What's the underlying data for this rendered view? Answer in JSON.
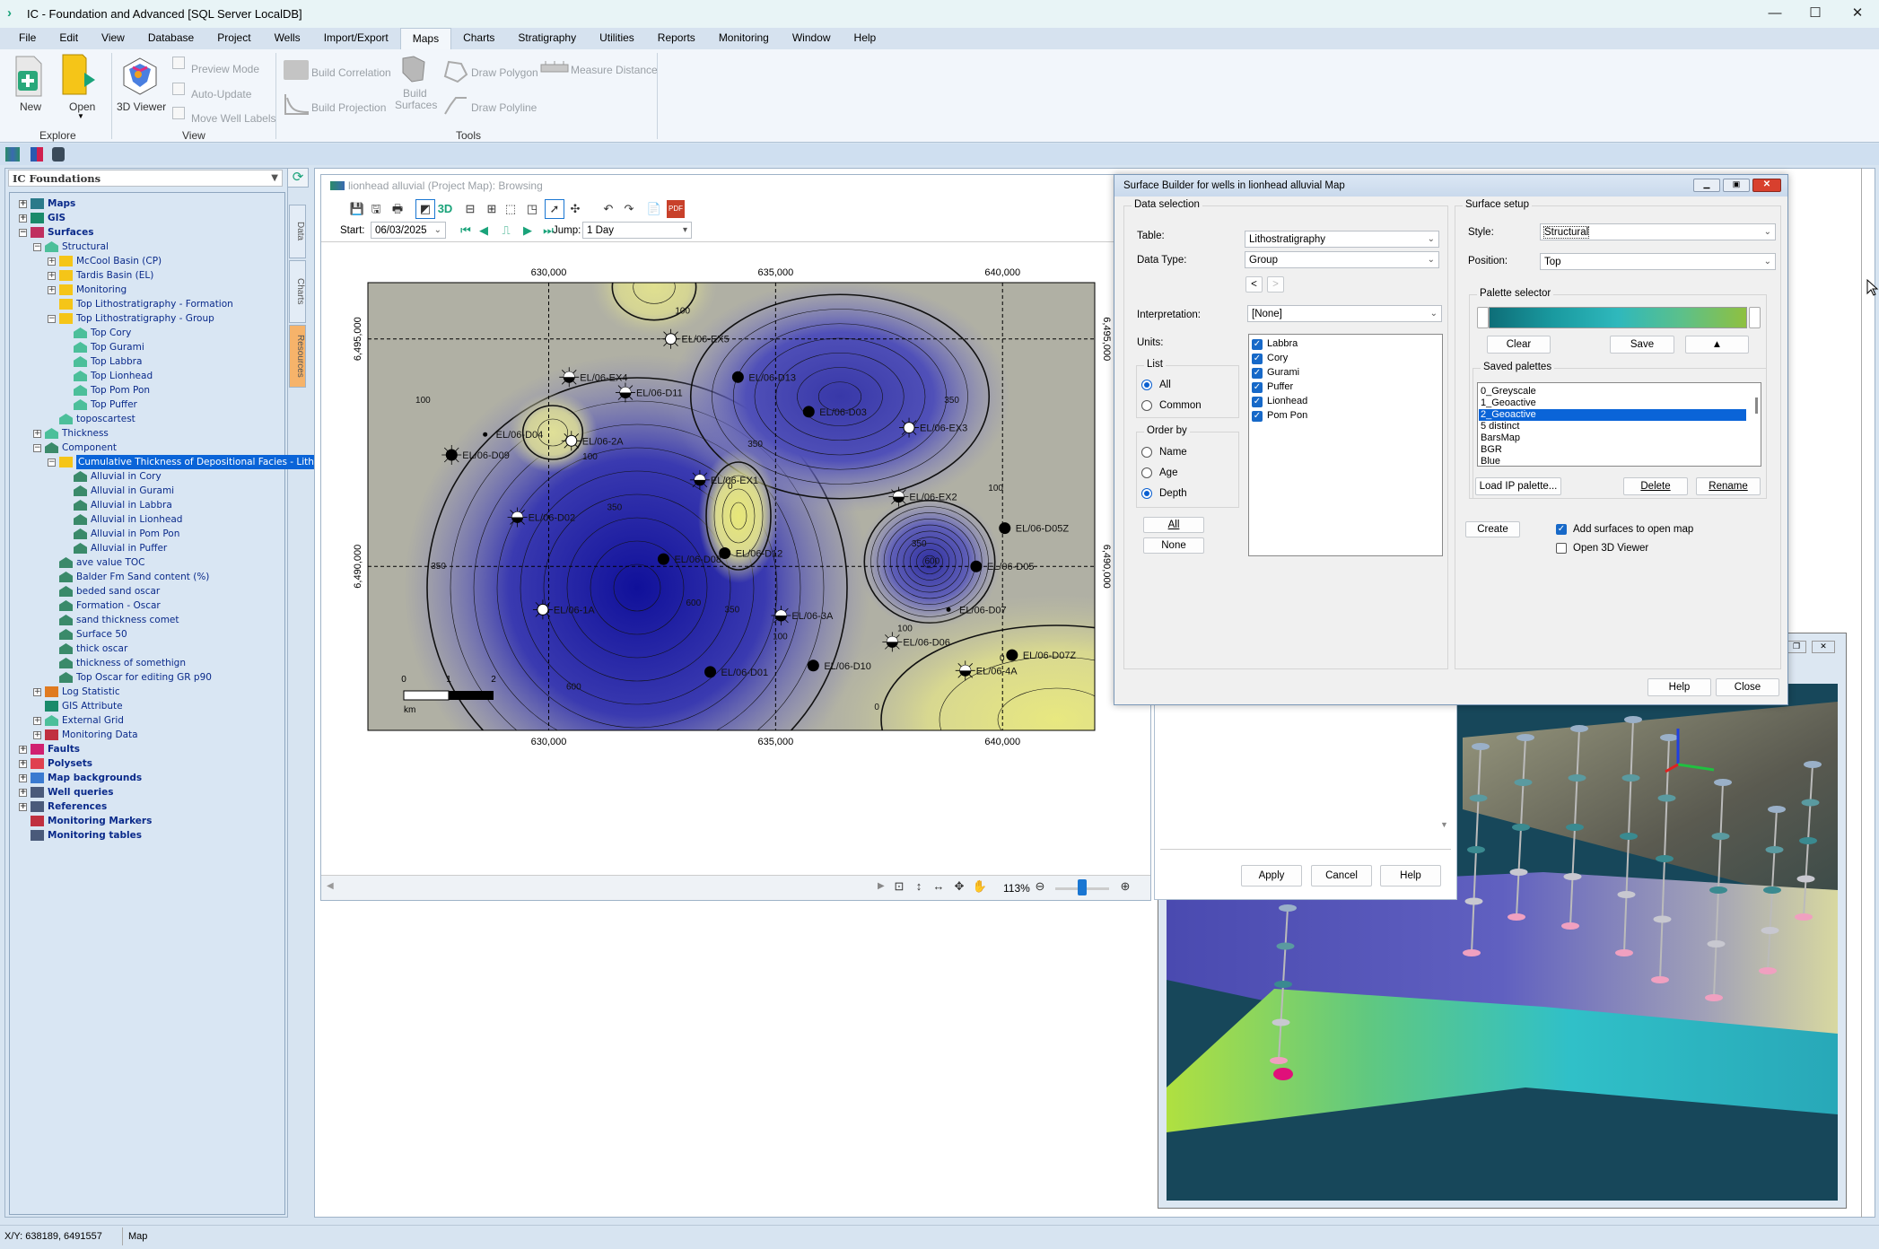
{
  "window": {
    "title": "IC - Foundation and Advanced [SQL Server LocalDB]",
    "controls": [
      "minimize",
      "maximize",
      "close"
    ]
  },
  "menu": [
    "File",
    "Edit",
    "View",
    "Database",
    "Project",
    "Wells",
    "Import/Export",
    "Maps",
    "Charts",
    "Stratigraphy",
    "Utilities",
    "Reports",
    "Monitoring",
    "Window",
    "Help"
  ],
  "menu_active": "Maps",
  "ribbon": {
    "new": "New",
    "open": "Open",
    "explore": "Explore",
    "viewer3d": "3D Viewer",
    "preview_mode": "Preview Mode",
    "auto_update": "Auto-Update",
    "move_well_labels": "Move Well Labels",
    "view": "View",
    "build_correlation": "Build Correlation",
    "build_projection": "Build Projection",
    "build_surfaces_1": "Build",
    "build_surfaces_2": "Surfaces",
    "draw_polygon": "Draw Polygon",
    "draw_polyline": "Draw Polyline",
    "measure_distance": "Measure Distance",
    "tools": "Tools"
  },
  "left_panel": {
    "project_select": "IC Foundations",
    "side_tabs": [
      "Data",
      "Charts",
      "Resources"
    ],
    "tree": [
      {
        "l": 0,
        "t": "Maps",
        "e": "+",
        "i": "maps",
        "b": true
      },
      {
        "l": 0,
        "t": "GIS",
        "e": "+",
        "i": "gis",
        "b": true
      },
      {
        "l": 0,
        "t": "Surfaces",
        "e": "-",
        "i": "surfaces",
        "b": true
      },
      {
        "l": 1,
        "t": "Structural",
        "e": "-",
        "i": "surf"
      },
      {
        "l": 2,
        "t": "McCool Basin (CP)",
        "e": "+",
        "i": "folder"
      },
      {
        "l": 2,
        "t": "Tardis Basin (EL)",
        "e": "+",
        "i": "folder"
      },
      {
        "l": 2,
        "t": "Monitoring",
        "e": "+",
        "i": "folder"
      },
      {
        "l": 2,
        "t": "Top Lithostratigraphy - Formation",
        "e": "",
        "i": "folder"
      },
      {
        "l": 2,
        "t": "Top Lithostratigraphy - Group",
        "e": "-",
        "i": "folder"
      },
      {
        "l": 3,
        "t": "Top Cory",
        "e": "",
        "i": "surf"
      },
      {
        "l": 3,
        "t": "Top Gurami",
        "e": "",
        "i": "surf"
      },
      {
        "l": 3,
        "t": "Top Labbra",
        "e": "",
        "i": "surf"
      },
      {
        "l": 3,
        "t": "Top Lionhead",
        "e": "",
        "i": "surf"
      },
      {
        "l": 3,
        "t": "Top Pom Pon",
        "e": "",
        "i": "surf"
      },
      {
        "l": 3,
        "t": "Top Puffer",
        "e": "",
        "i": "surf"
      },
      {
        "l": 2,
        "t": "toposcartest",
        "e": "",
        "i": "surf"
      },
      {
        "l": 1,
        "t": "Thickness",
        "e": "+",
        "i": "thick"
      },
      {
        "l": 1,
        "t": "Component",
        "e": "-",
        "i": "comp"
      },
      {
        "l": 2,
        "t": "Cumulative Thickness of Depositional Facies - Lith",
        "e": "-",
        "i": "folder",
        "s": true
      },
      {
        "l": 3,
        "t": "Alluvial in Cory",
        "e": "",
        "i": "comp"
      },
      {
        "l": 3,
        "t": "Alluvial in Gurami",
        "e": "",
        "i": "comp"
      },
      {
        "l": 3,
        "t": "Alluvial in Labbra",
        "e": "",
        "i": "comp"
      },
      {
        "l": 3,
        "t": "Alluvial in Lionhead",
        "e": "",
        "i": "comp"
      },
      {
        "l": 3,
        "t": "Alluvial in Pom Pon",
        "e": "",
        "i": "comp"
      },
      {
        "l": 3,
        "t": "Alluvial in Puffer",
        "e": "",
        "i": "comp"
      },
      {
        "l": 2,
        "t": "ave value TOC",
        "e": "",
        "i": "comp"
      },
      {
        "l": 2,
        "t": "Balder Fm Sand content (%)",
        "e": "",
        "i": "comp"
      },
      {
        "l": 2,
        "t": "beded sand oscar",
        "e": "",
        "i": "comp"
      },
      {
        "l": 2,
        "t": "Formation - Oscar",
        "e": "",
        "i": "comp"
      },
      {
        "l": 2,
        "t": "sand thickness comet",
        "e": "",
        "i": "comp"
      },
      {
        "l": 2,
        "t": "Surface 50",
        "e": "",
        "i": "comp"
      },
      {
        "l": 2,
        "t": "thick oscar",
        "e": "",
        "i": "comp"
      },
      {
        "l": 2,
        "t": "thickness of somethign",
        "e": "",
        "i": "comp"
      },
      {
        "l": 2,
        "t": "Top Oscar for editing GR p90",
        "e": "",
        "i": "comp"
      },
      {
        "l": 1,
        "t": "Log Statistic",
        "e": "+",
        "i": "logstat"
      },
      {
        "l": 1,
        "t": "GIS Attribute",
        "e": "",
        "i": "gis"
      },
      {
        "l": 1,
        "t": "External Grid",
        "e": "+",
        "i": "surf"
      },
      {
        "l": 1,
        "t": "Monitoring Data",
        "e": "+",
        "i": "monitor"
      },
      {
        "l": 0,
        "t": "Faults",
        "e": "+",
        "i": "faults",
        "b": true
      },
      {
        "l": 0,
        "t": "Polysets",
        "e": "+",
        "i": "polysets",
        "b": true
      },
      {
        "l": 0,
        "t": "Map backgrounds",
        "e": "+",
        "i": "bmp",
        "b": true
      },
      {
        "l": 0,
        "t": "Well queries",
        "e": "+",
        "i": "table",
        "b": true
      },
      {
        "l": 0,
        "t": "References",
        "e": "+",
        "i": "table",
        "b": true
      },
      {
        "l": 0,
        "t": "Monitoring Markers",
        "e": "",
        "i": "monitor",
        "b": true
      },
      {
        "l": 0,
        "t": "Monitoring tables",
        "e": "",
        "i": "table",
        "b": true
      }
    ]
  },
  "map_window": {
    "title": "lionhead alluvial (Project Map): Browsing",
    "toolbar": [
      "save",
      "save-as",
      "print",
      "shade",
      "3d",
      "zoom-out",
      "zoom-in",
      "zoom-select",
      "select-well",
      "pointer",
      "extent",
      "undo",
      "redo",
      "report",
      "pdf"
    ],
    "toolbar_3d_label": "3D",
    "toolbar_pdf_label": "PDF",
    "start_label": "Start:",
    "start_date": "06/03/2025",
    "jump_label": "Jump:",
    "jump_value": "1 Day",
    "zoom_level": "113%",
    "zoom_slider_fraction": 0.5
  },
  "map": {
    "extent": {
      "e_min": 626016,
      "e_max": 642032,
      "n_min": 6486395,
      "n_max": 6496237
    },
    "e_ticks": [
      "630,000",
      "635,000",
      "640,000"
    ],
    "e_tick_values": [
      630000,
      635000,
      640000
    ],
    "n_ticks": [
      "6,490,000",
      "6,495,000"
    ],
    "n_tick_values": [
      6490000,
      6495000
    ],
    "scale_bar": {
      "labels": [
        "0",
        "1",
        "2"
      ],
      "unit": "km"
    },
    "wells": [
      {
        "name": "EL/06-EX5",
        "e": 632690,
        "n": 6495000,
        "sym": "white"
      },
      {
        "name": "EL/06-EX4",
        "e": 630450,
        "n": 6494160,
        "sym": "half"
      },
      {
        "name": "EL/06-D11",
        "e": 631690,
        "n": 6493820,
        "sym": "half"
      },
      {
        "name": "EL/06-D13",
        "e": 634170,
        "n": 6494160,
        "sym": "black"
      },
      {
        "name": "EL/06-D03",
        "e": 635730,
        "n": 6493400,
        "sym": "black"
      },
      {
        "name": "EL/06-EX3",
        "e": 637940,
        "n": 6493050,
        "sym": "white"
      },
      {
        "name": "EL/06-D04",
        "e": 628600,
        "n": 6492900,
        "sym": "dot"
      },
      {
        "name": "EL/06-2A",
        "e": 630500,
        "n": 6492760,
        "sym": "white"
      },
      {
        "name": "EL/06-D09",
        "e": 627860,
        "n": 6492450,
        "sym": "star"
      },
      {
        "name": "EL/06-EX1",
        "e": 633330,
        "n": 6491900,
        "sym": "half"
      },
      {
        "name": "EL/06-EX2",
        "e": 637710,
        "n": 6491530,
        "sym": "half"
      },
      {
        "name": "EL/06-D02",
        "e": 629310,
        "n": 6491080,
        "sym": "half"
      },
      {
        "name": "EL/06-D05Z",
        "e": 640050,
        "n": 6490840,
        "sym": "black"
      },
      {
        "name": "EL/06-D12",
        "e": 633880,
        "n": 6490290,
        "sym": "black"
      },
      {
        "name": "EL/06-D08",
        "e": 632530,
        "n": 6490160,
        "sym": "black"
      },
      {
        "name": "EL/06-D05",
        "e": 639420,
        "n": 6490000,
        "sym": "black"
      },
      {
        "name": "EL/06-1A",
        "e": 629870,
        "n": 6489050,
        "sym": "white"
      },
      {
        "name": "EL/06-3A",
        "e": 635120,
        "n": 6488920,
        "sym": "half"
      },
      {
        "name": "EL/06-D07",
        "e": 638810,
        "n": 6489050,
        "sym": "dot"
      },
      {
        "name": "EL/06-D06",
        "e": 637570,
        "n": 6488340,
        "sym": "half"
      },
      {
        "name": "EL/06-D07Z",
        "e": 640210,
        "n": 6488050,
        "sym": "black"
      },
      {
        "name": "EL/06-D10",
        "e": 635830,
        "n": 6487820,
        "sym": "black"
      },
      {
        "name": "EL/06-4A",
        "e": 639180,
        "n": 6487710,
        "sym": "half"
      },
      {
        "name": "EL/06-D01",
        "e": 633560,
        "n": 6487680,
        "sym": "black"
      }
    ],
    "contour_labels": [
      {
        "t": "100",
        "e": 632950,
        "n": 6495560
      },
      {
        "t": "100",
        "e": 627230,
        "n": 6493590
      },
      {
        "t": "100",
        "e": 630910,
        "n": 6492350
      },
      {
        "t": "350",
        "e": 638880,
        "n": 6493590
      },
      {
        "t": "350",
        "e": 634550,
        "n": 6492630
      },
      {
        "t": "350",
        "e": 631450,
        "n": 6491240
      },
      {
        "t": "350",
        "e": 627570,
        "n": 6489950
      },
      {
        "t": "350",
        "e": 638160,
        "n": 6490440
      },
      {
        "t": "350",
        "e": 634040,
        "n": 6488990
      },
      {
        "t": "600",
        "e": 638450,
        "n": 6490050
      },
      {
        "t": "600",
        "e": 633190,
        "n": 6489140
      },
      {
        "t": "600",
        "e": 630550,
        "n": 6487290
      },
      {
        "t": "100",
        "e": 639850,
        "n": 6491660
      },
      {
        "t": "100",
        "e": 637850,
        "n": 6488570
      },
      {
        "t": "100",
        "e": 635100,
        "n": 6488400
      },
      {
        "t": "0",
        "e": 634000,
        "n": 6491700
      },
      {
        "t": "0",
        "e": 639990,
        "n": 6487920
      },
      {
        "t": "0",
        "e": 637230,
        "n": 6486850
      }
    ]
  },
  "dialog": {
    "title": "Surface Builder for wells in lionhead alluvial Map",
    "data_selection": "Data selection",
    "table_label": "Table:",
    "table_value": "Lithostratigraphy",
    "data_type_label": "Data Type:",
    "data_type_value": "Group",
    "prev": "<",
    "next": ">",
    "interpretation_label": "Interpretation:",
    "interpretation_value": "[None]",
    "units_label": "Units:",
    "units": [
      {
        "t": "Labbra",
        "c": true
      },
      {
        "t": "Cory",
        "c": true
      },
      {
        "t": "Gurami",
        "c": true
      },
      {
        "t": "Puffer",
        "c": true
      },
      {
        "t": "Lionhead",
        "c": true
      },
      {
        "t": "Pom Pon",
        "c": true
      }
    ],
    "list_group": "List",
    "list_all": "All",
    "list_common": "Common",
    "list_selected": "All",
    "order_group": "Order by",
    "order_name": "Name",
    "order_age": "Age",
    "order_depth": "Depth",
    "order_selected": "Depth",
    "all_button": "All",
    "none_button": "None",
    "surface_setup": "Surface setup",
    "style_label": "Style:",
    "style_value": "Structural",
    "position_label": "Position:",
    "position_value": "Top",
    "palette_selector": "Palette selector",
    "palette_colors": [
      "#0e6e78",
      "#1a9aa0",
      "#2fb8bc",
      "#5cc08a",
      "#8fc040"
    ],
    "clear": "Clear",
    "save": "Save",
    "up": "▲",
    "saved_palettes": "Saved palettes",
    "palettes": [
      "0_Greyscale",
      "1_Geoactive",
      "2_Geoactive",
      "5 distinct",
      "BarsMap",
      "BGR",
      "Blue"
    ],
    "palette_selected": "2_Geoactive",
    "load_ip": "Load IP palette...",
    "delete": "Delete",
    "rename": "Rename",
    "create": "Create",
    "add_surfaces": "Add surfaces to open map",
    "add_surfaces_checked": true,
    "open_3d": "Open 3D Viewer",
    "open_3d_checked": false,
    "help": "Help",
    "close": "Close"
  },
  "behind_dialog": {
    "apply": "Apply",
    "cancel": "Cancel",
    "help": "Help"
  },
  "status": {
    "xy": "X/Y: 638189, 6491557",
    "mode": "Map"
  }
}
